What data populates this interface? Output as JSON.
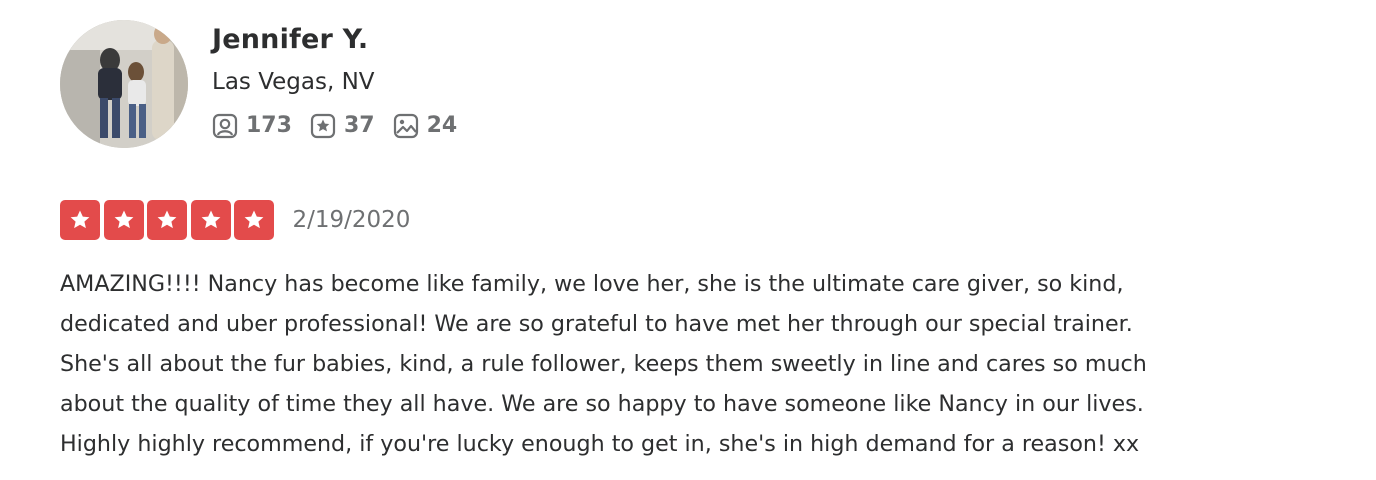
{
  "reviewer": {
    "name": "Jennifer Y.",
    "location": "Las Vegas, NV",
    "stats": {
      "friends": "173",
      "reviews": "37",
      "photos": "24"
    },
    "icons": {
      "friends": "friends-icon",
      "reviews": "review-star-icon",
      "photos": "photo-icon"
    }
  },
  "review": {
    "rating": 5,
    "rating_max": 5,
    "star_color": "#e34b4b",
    "date": "2/19/2020",
    "text": "AMAZING!!!! Nancy has become like family, we love her, she is the ultimate care giver, so kind,\ndedicated and uber professional!  We are so grateful to have met her through our special trainer.\n She's all about the fur babies, kind, a rule follower, keeps them sweetly in line and cares so much\nabout the quality of time they all have.  We are so happy to have someone like Nancy in our lives.\n Highly highly recommend, if you're lucky enough to get in, she's in high demand for a reason! xx"
  }
}
